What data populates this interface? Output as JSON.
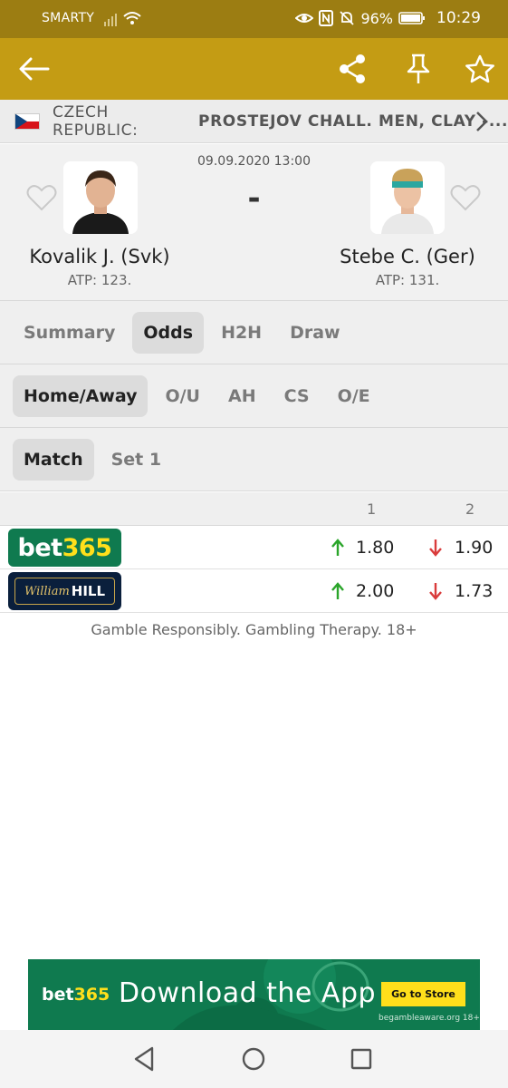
{
  "status_bar": {
    "carrier": "SMARTY",
    "battery": "96%",
    "time": "10:29"
  },
  "app_bar": {
    "back_icon": "arrow-left-icon",
    "share_icon": "share-icon",
    "pin_icon": "pin-icon",
    "star_icon": "star-icon"
  },
  "league": {
    "country": "CZECH REPUBLIC:",
    "name": "PROSTEJOV CHALL. MEN, CLAY -...",
    "flag": "czech-flag"
  },
  "match": {
    "datetime": "09.09.2020 13:00",
    "score": "-",
    "home": {
      "name": "Kovalik J. (Svk)",
      "rank": "ATP: 123."
    },
    "away": {
      "name": "Stebe C. (Ger)",
      "rank": "ATP: 131."
    }
  },
  "tabs": [
    {
      "label": "Summary",
      "active": false
    },
    {
      "label": "Odds",
      "active": true
    },
    {
      "label": "H2H",
      "active": false
    },
    {
      "label": "Draw",
      "active": false
    }
  ],
  "market_tabs": [
    {
      "label": "Home/Away",
      "active": true
    },
    {
      "label": "O/U",
      "active": false
    },
    {
      "label": "AH",
      "active": false
    },
    {
      "label": "CS",
      "active": false
    },
    {
      "label": "O/E",
      "active": false
    }
  ],
  "period_tabs": [
    {
      "label": "Match",
      "active": true
    },
    {
      "label": "Set 1",
      "active": false
    }
  ],
  "odds": {
    "col1": "1",
    "col2": "2",
    "rows": [
      {
        "bookmaker": "bet365",
        "odd1": "1.80",
        "odd1_trend": "up",
        "odd2": "1.90",
        "odd2_trend": "down"
      },
      {
        "bookmaker": "William HILL",
        "odd1": "2.00",
        "odd1_trend": "up",
        "odd2": "1.73",
        "odd2_trend": "down"
      }
    ]
  },
  "disclaimer": "Gamble Responsibly. Gambling Therapy. 18+",
  "ad": {
    "brand": "bet365",
    "headline": "Download the App",
    "cta": "Go to Store",
    "footer": "begambleaware.org 18+"
  },
  "colors": {
    "status_bar": "#9c7d12",
    "app_bar": "#c49c14",
    "up": "#2aa52a",
    "down": "#d93b3b",
    "bet365": "#0f7a4f",
    "william_hill": "#0a1f3c"
  }
}
